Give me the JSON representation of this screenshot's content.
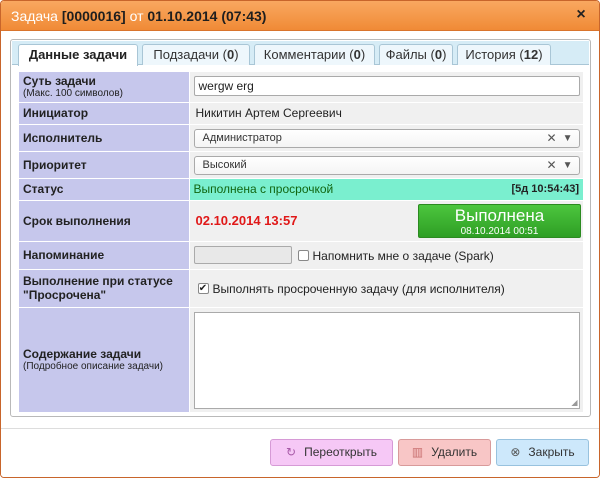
{
  "window": {
    "title_prefix": "Задача",
    "task_id": "[0000016]",
    "title_mid": "от",
    "created": "01.10.2014 (07:43)",
    "close_symbol": "×"
  },
  "tabs": [
    {
      "label": "Данные задачи",
      "count": ""
    },
    {
      "label": "Подзадачи (",
      "count": "0",
      "suffix": ")"
    },
    {
      "label": "Комментарии (",
      "count": "0",
      "suffix": ")"
    },
    {
      "label": "Файлы (",
      "count": "0",
      "suffix": ")"
    },
    {
      "label": "История (",
      "count": "12",
      "suffix": ")"
    }
  ],
  "form": {
    "subject_label": "Суть задачи",
    "subject_hint": "(Макс. 100 символов)",
    "subject_value": "wergw erg",
    "initiator_label": "Инициатор",
    "initiator_value": "Никитин Артем Сергеевич",
    "executor_label": "Исполнитель",
    "executor_value": "Администратор",
    "priority_label": "Приоритет",
    "priority_value": "Высокий",
    "status_label": "Статус",
    "status_value": "Выполнена с просрочкой",
    "status_time": "[5д 10:54:43]",
    "due_label": "Срок выполнения",
    "due_value": "02.10.2014 13:57",
    "done_button_label": "Выполнена",
    "done_button_date": "08.10.2014 00:51",
    "reminder_label": "Напоминание",
    "reminder_value": "",
    "reminder_checkbox_label": "Напомнить мне о задаче (Spark)",
    "reminder_checked": false,
    "overdue_label": "Выполнение при статусе \"Просрочена\"",
    "overdue_checkbox_label": "Выполнять просроченную задачу (для исполнителя)",
    "overdue_checked": true,
    "content_label": "Содержание задачи",
    "content_hint": "(Подробное описание задачи)",
    "content_value": ""
  },
  "footer": {
    "reopen_label": "Переоткрыть",
    "delete_label": "Удалить",
    "close_label": "Закрыть"
  },
  "colors": {
    "titlebar": "#f08a36",
    "label_bg": "#c6c7ec",
    "status_bg": "#7aefcf",
    "due_text": "#e01818",
    "done_button": "#2e9e24"
  }
}
